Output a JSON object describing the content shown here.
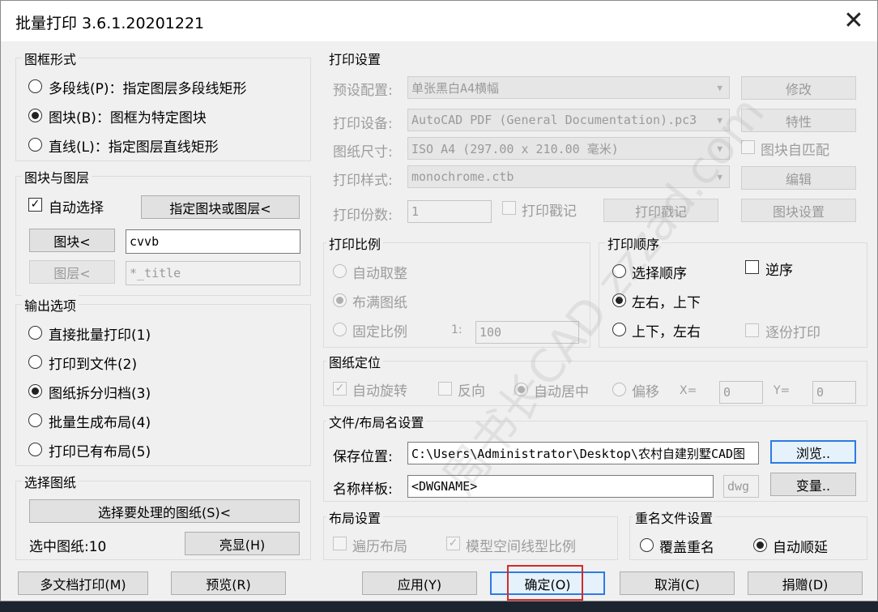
{
  "window": {
    "title": "批量打印 3.6.1.20201221",
    "close_label": "✕"
  },
  "frame_form": {
    "label": "图框形式",
    "options": [
      {
        "label": "多段线(P)：指定图层多段线矩形",
        "checked": false
      },
      {
        "label": "图块(B)：图框为特定图块",
        "checked": true
      },
      {
        "label": "直线(L)：指定图层直线矩形",
        "checked": false
      }
    ]
  },
  "block_layer": {
    "label": "图块与图层",
    "auto_select_label": "自动选择",
    "auto_select_checked": true,
    "specify_button": "指定图块或图层<",
    "block_button": "图块<",
    "block_value": "cvvb",
    "layer_button": "图层<",
    "layer_value": "*_title"
  },
  "output_options": {
    "label": "输出选项",
    "options": [
      {
        "label": "直接批量打印(1)",
        "checked": false
      },
      {
        "label": "打印到文件(2)",
        "checked": false
      },
      {
        "label": "图纸拆分归档(3)",
        "checked": true
      },
      {
        "label": "批量生成布局(4)",
        "checked": false
      },
      {
        "label": "打印已有布局(5)",
        "checked": false
      }
    ]
  },
  "select_sheets": {
    "label": "选择图纸",
    "select_button": "选择要处理的图纸(S)<",
    "selected_count_label": "选中图纸:10",
    "highlight_button": "亮显(H)"
  },
  "print_settings": {
    "label": "打印设置",
    "preset_label": "预设配置:",
    "preset_value": "单张黑白A4横幅",
    "modify_button": "修改",
    "device_label": "打印设备:",
    "device_value": "AutoCAD PDF (General Documentation).pc3",
    "properties_button": "特性",
    "paper_label": "图纸尺寸:",
    "paper_value": "ISO A4 (297.00 x 210.00 毫米)",
    "block_match_label": "图块自匹配",
    "style_label": "打印样式:",
    "style_value": "monochrome.ctb",
    "edit_button": "编辑",
    "copies_label": "打印份数:",
    "copies_value": "1",
    "stamp_check_label": "打印戳记",
    "stamp_button": "打印戳记",
    "block_settings_button": "图块设置"
  },
  "print_scale": {
    "label": "打印比例",
    "options": [
      {
        "label": "自动取整",
        "checked": false
      },
      {
        "label": "布满图纸",
        "checked": true
      },
      {
        "label": "固定比例",
        "checked": false
      }
    ],
    "ratio_prefix": "1:",
    "ratio_value": "100"
  },
  "print_order": {
    "label": "打印顺序",
    "options": [
      {
        "label": "选择顺序",
        "checked": false
      },
      {
        "label": "左右，上下",
        "checked": true
      },
      {
        "label": "上下，左右",
        "checked": false
      }
    ],
    "reverse_label": "逆序",
    "collate_label": "逐份打印"
  },
  "paper_position": {
    "label": "图纸定位",
    "auto_rotate_label": "自动旋转",
    "reverse_label": "反向",
    "auto_center_label": "自动居中",
    "offset_label": "偏移",
    "x_label": "X=",
    "x_value": "0",
    "y_label": "Y=",
    "y_value": "0"
  },
  "file_name": {
    "label": "文件/布局名设置",
    "save_label": "保存位置:",
    "save_value": "C:\\Users\\Administrator\\Desktop\\农村自建别墅CAD图",
    "browse_button": "浏览..",
    "template_label": "名称样板:",
    "template_value": "<DWGNAME>",
    "template_ext": "dwg",
    "variable_button": "变量.."
  },
  "layout_settings": {
    "label": "布局设置",
    "traverse_label": "遍历布局",
    "model_linetype_label": "模型空间线型比例"
  },
  "duplicate_settings": {
    "label": "重名文件设置",
    "overwrite_label": "覆盖重名",
    "auto_increment_label": "自动顺延"
  },
  "footer": {
    "multi_doc_button": "多文档打印(M)",
    "preview_button": "预览(R)",
    "apply_button": "应用(Y)",
    "ok_button": "确定(O)",
    "cancel_button": "取消(C)",
    "donate_button": "捐赠(D)"
  },
  "watermark": "周书长CAD zzzad.com",
  "colors": {
    "highlight": "#d42a2a",
    "focus": "#2c7be5"
  }
}
